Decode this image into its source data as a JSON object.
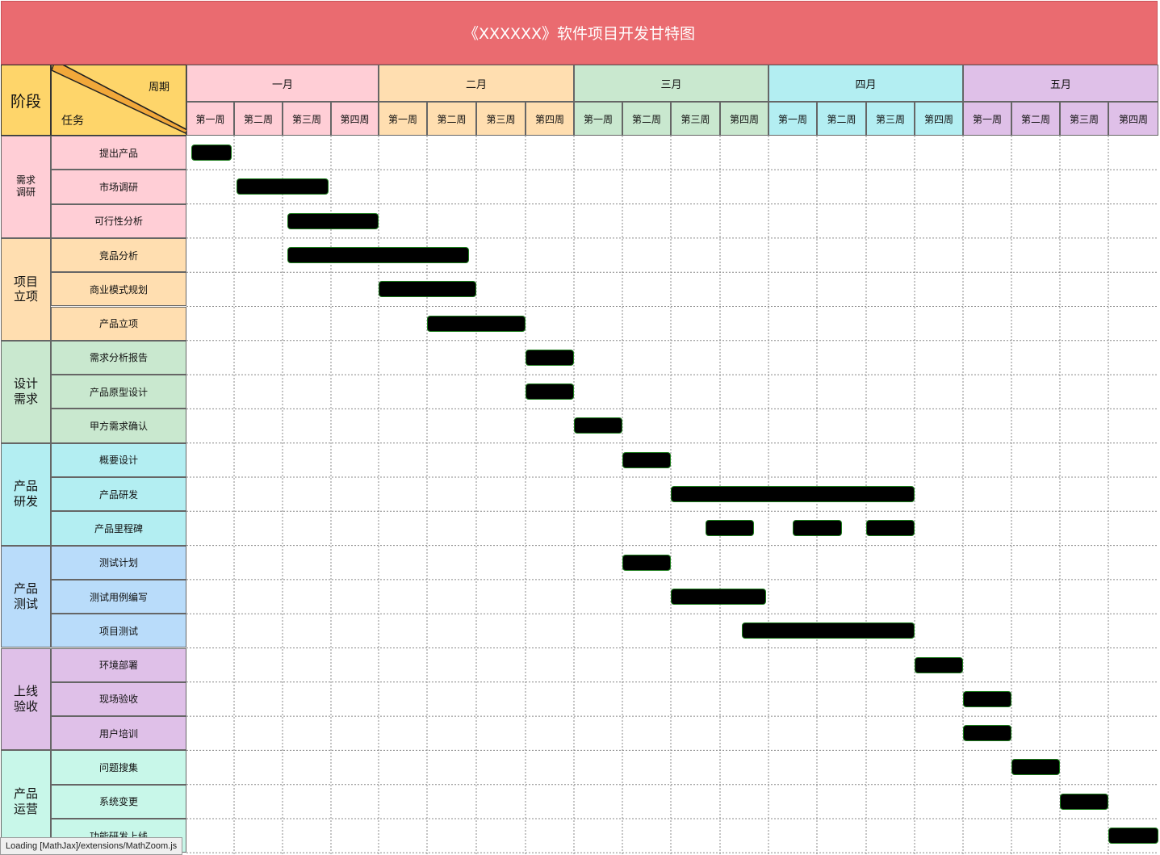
{
  "title": "《XXXXXX》软件项目开发甘特图",
  "corner": {
    "stage_label": "阶段",
    "period_label": "周期",
    "task_label": "任务"
  },
  "colors": {
    "title_bg": "#ea6b70",
    "corner_bg": "#fed56a",
    "bar_fill": "#000000",
    "bar_border": "#1a7a1a"
  },
  "months": [
    {
      "label": "一月",
      "color": "#ffced6"
    },
    {
      "label": "二月",
      "color": "#ffdeb0"
    },
    {
      "label": "三月",
      "color": "#c9e8cf"
    },
    {
      "label": "四月",
      "color": "#b3eef2"
    },
    {
      "label": "五月",
      "color": "#dfc0e8"
    }
  ],
  "week_labels": [
    "第一周",
    "第二周",
    "第三周",
    "第四周"
  ],
  "stages": [
    {
      "label": "需求\n调研",
      "color": "#ffced6",
      "small": true,
      "tasks": [
        "提出产品",
        "市场调研",
        "可行性分析"
      ]
    },
    {
      "label": "项目\n立项",
      "color": "#ffdeb0",
      "tasks": [
        "竞品分析",
        "商业模式规划",
        "产品立项"
      ]
    },
    {
      "label": "设计\n需求",
      "color": "#c9e8cf",
      "tasks": [
        "需求分析报告",
        "产品原型设计",
        "甲方需求确认"
      ]
    },
    {
      "label": "产品\n研发",
      "color": "#b3eef2",
      "tasks": [
        "概要设计",
        "产品研发",
        "产品里程碑"
      ]
    },
    {
      "label": "产品\n测试",
      "color": "#b9dcfa",
      "tasks": [
        "测试计划",
        "测试用例编写",
        "项目测试"
      ]
    },
    {
      "label": "上线\n验收",
      "color": "#dfc0e8",
      "tasks": [
        "环境部署",
        "现场验收",
        "用户培训"
      ]
    },
    {
      "label": "产品\n运营",
      "color": "#c8f7e9",
      "tasks": [
        "问题搜集",
        "系统变更",
        "功能研发上线"
      ]
    }
  ],
  "schedule": [
    {
      "task": "提出产品",
      "spans": [
        [
          0.1,
          0.95
        ]
      ]
    },
    {
      "task": "市场调研",
      "spans": [
        [
          1.05,
          2.95
        ]
      ]
    },
    {
      "task": "可行性分析",
      "spans": [
        [
          2.1,
          4.0
        ]
      ]
    },
    {
      "task": "竞品分析",
      "spans": [
        [
          2.1,
          5.85
        ]
      ]
    },
    {
      "task": "商业模式规划",
      "spans": [
        [
          4.0,
          6.0
        ]
      ]
    },
    {
      "task": "产品立项",
      "spans": [
        [
          5.0,
          7.0
        ]
      ]
    },
    {
      "task": "需求分析报告",
      "spans": [
        [
          7.0,
          8.0
        ]
      ]
    },
    {
      "task": "产品原型设计",
      "spans": [
        [
          7.0,
          8.0
        ]
      ]
    },
    {
      "task": "甲方需求确认",
      "spans": [
        [
          8.0,
          9.0
        ]
      ]
    },
    {
      "task": "概要设计",
      "spans": [
        [
          9.0,
          10.0
        ]
      ]
    },
    {
      "task": "产品研发",
      "spans": [
        [
          10.0,
          15.0
        ]
      ]
    },
    {
      "task": "产品里程碑",
      "spans": [
        [
          10.7,
          11.7
        ],
        [
          12.5,
          13.5
        ],
        [
          14.0,
          15.0
        ]
      ]
    },
    {
      "task": "测试计划",
      "spans": [
        [
          9.0,
          10.0
        ]
      ]
    },
    {
      "task": "测试用例编写",
      "spans": [
        [
          10.0,
          11.95
        ]
      ]
    },
    {
      "task": "项目测试",
      "spans": [
        [
          11.45,
          15.0
        ]
      ]
    },
    {
      "task": "环境部署",
      "spans": [
        [
          15.0,
          16.0
        ]
      ]
    },
    {
      "task": "现场验收",
      "spans": [
        [
          16.0,
          17.0
        ]
      ]
    },
    {
      "task": "用户培训",
      "spans": [
        [
          16.0,
          17.0
        ]
      ]
    },
    {
      "task": "问题搜集",
      "spans": [
        [
          17.0,
          18.0
        ]
      ]
    },
    {
      "task": "系统变更",
      "spans": [
        [
          18.0,
          19.0
        ]
      ]
    },
    {
      "task": "功能研发上线",
      "spans": [
        [
          19.0,
          20.0
        ]
      ]
    }
  ],
  "status_bar": "Loading [MathJax]/extensions/MathZoom.js"
}
